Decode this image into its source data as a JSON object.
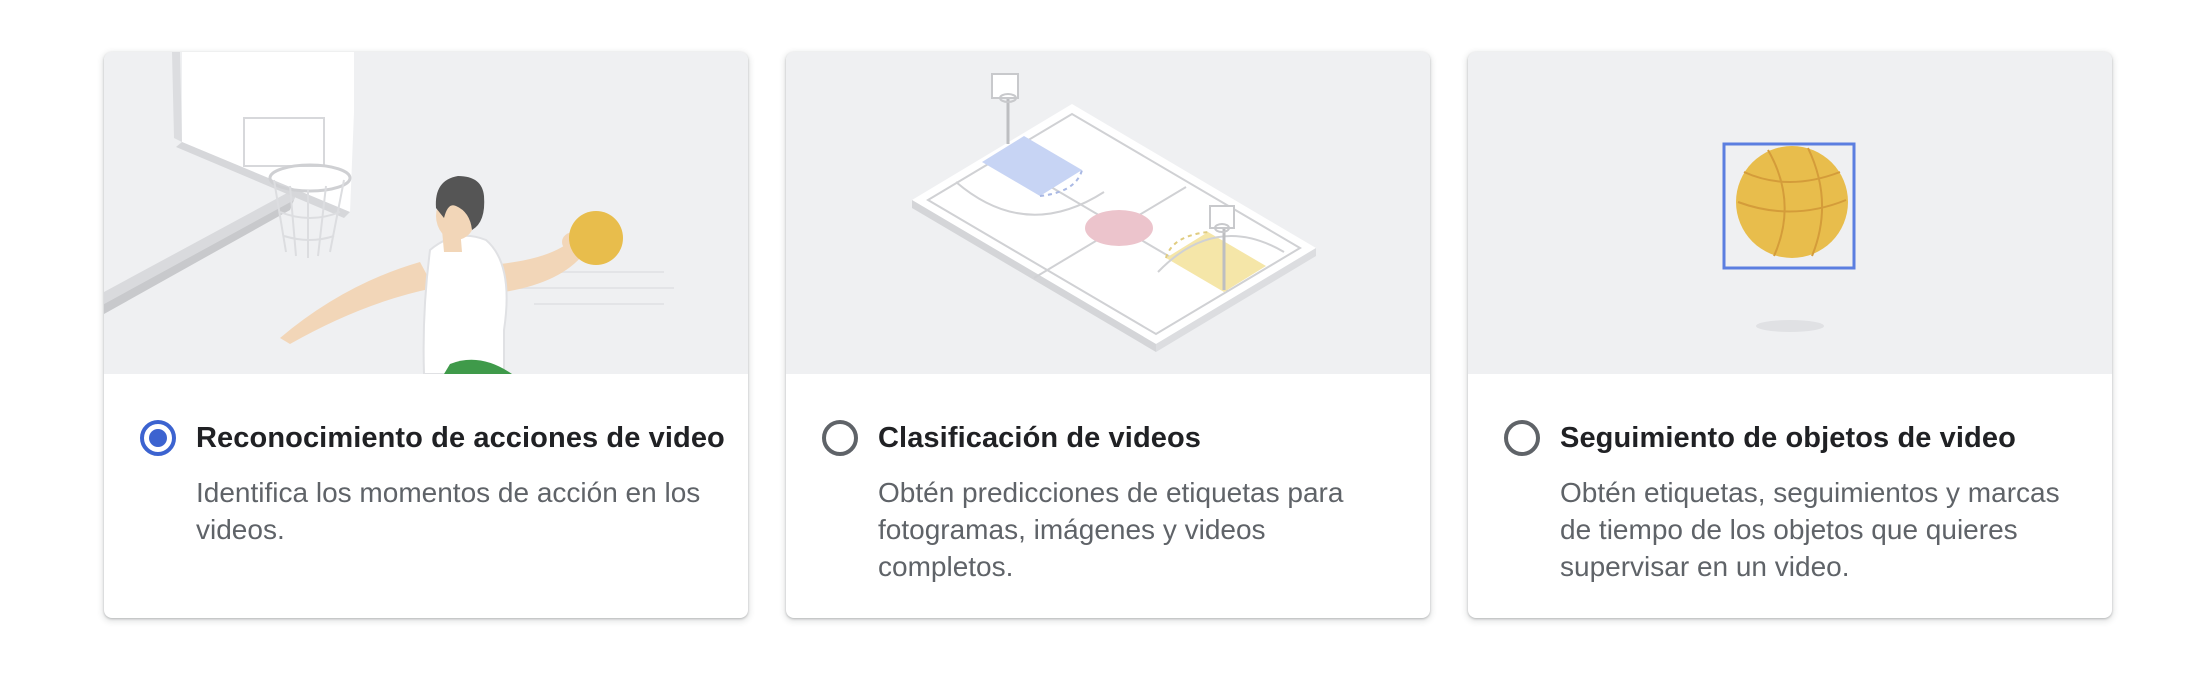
{
  "options": [
    {
      "title": "Reconocimiento de acciones de video",
      "description": "Identifica los momentos de acción en los videos.",
      "selected": true,
      "illustration": "basketball-player-dunk-icon"
    },
    {
      "title": "Clasificación de videos",
      "description": "Obtén predicciones de etiquetas para fotogramas, imágenes y videos completos.",
      "selected": false,
      "illustration": "basketball-court-icon"
    },
    {
      "title": "Seguimiento de objetos de video",
      "description": "Obtén etiquetas, seguimientos y marcas de tiempo de los objetos que quieres supervisar en un video.",
      "selected": false,
      "illustration": "tracked-basketball-icon"
    }
  ],
  "colors": {
    "accent": "#3c63d0",
    "illustration_bg": "#eff0f2",
    "title": "#202124",
    "description": "#5f6368"
  }
}
